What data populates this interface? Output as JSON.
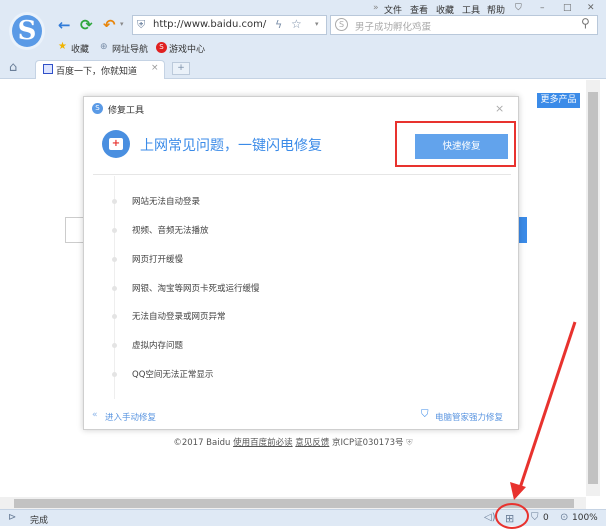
{
  "browser": {
    "menu": [
      "»",
      "文件",
      "查看",
      "收藏",
      "工具",
      "帮助"
    ],
    "window_controls": [
      "shirt-icon",
      "minimize",
      "maximize",
      "close"
    ],
    "url": "http://www.baidu.com/",
    "search_placeholder": "男子成功孵化鸡蛋",
    "bookmarks": [
      "收藏",
      "网址导航",
      "游戏中心"
    ],
    "tab_title": "百度一下，你就知道",
    "new_tab": "+"
  },
  "page": {
    "more_products": "更多产品",
    "footer": {
      "copyright": "©2017 Baidu",
      "link1": "使用百度前必读",
      "link2": "意见反馈",
      "icp": "京ICP证030173号"
    }
  },
  "dialog": {
    "title": "修复工具",
    "close": "×",
    "headline": "上网常见问题，一键闪电修复",
    "quick_fix": "快速修复",
    "items": [
      "网站无法自动登录",
      "视频、音频无法播放",
      "网页打开缓慢",
      "网银、淘宝等网页卡死或运行缓慢",
      "无法自动登录或网页异常",
      "虚拟内存问题",
      "QQ空间无法正常显示"
    ],
    "manual": "进入手动修复",
    "guard": "电脑管家强力修复"
  },
  "status": {
    "text": "完成",
    "count": "0",
    "zoom": "100%"
  },
  "colors": {
    "accent": "#3b8be8",
    "highlight": "#e8322e",
    "chrome": "#dfe9f5"
  }
}
